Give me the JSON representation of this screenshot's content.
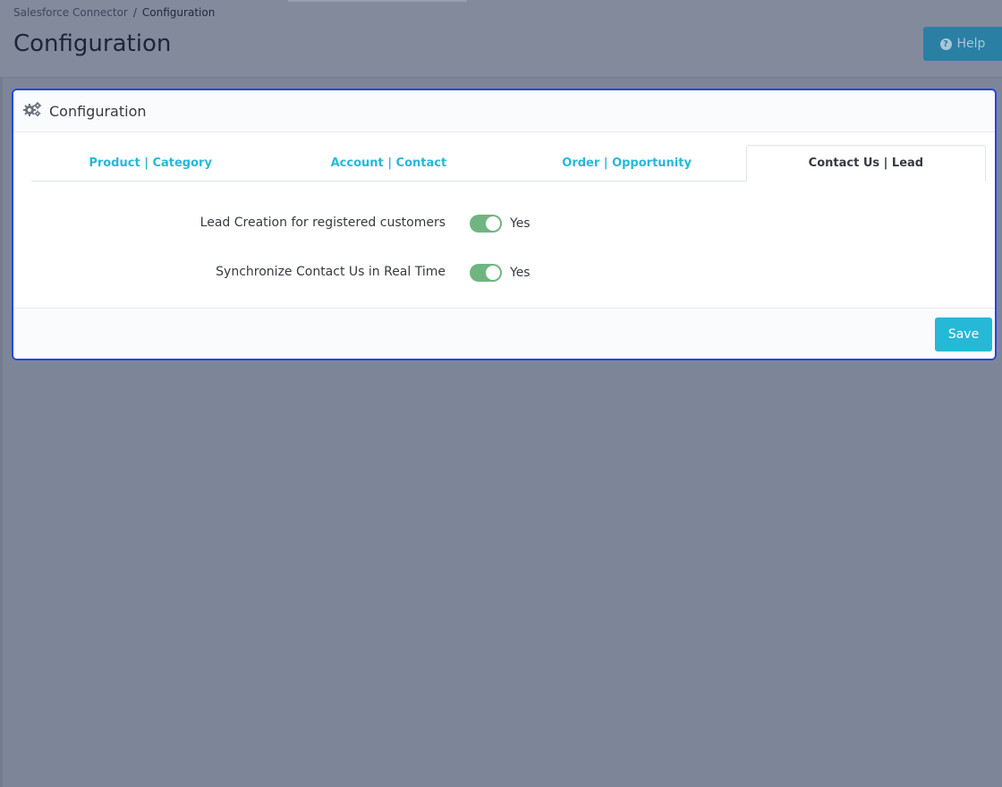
{
  "breadcrumb": {
    "parent": "Salesforce Connector",
    "separator": "/",
    "current": "Configuration"
  },
  "header": {
    "title": "Configuration",
    "help_label": "Help",
    "help_icon": "question-circle-icon"
  },
  "panel": {
    "title": "Configuration",
    "icon": "cogs-icon",
    "tabs": [
      {
        "label": "Product | Category",
        "active": false
      },
      {
        "label": "Account | Contact",
        "active": false
      },
      {
        "label": "Order | Opportunity",
        "active": false
      },
      {
        "label": "Contact Us | Lead",
        "active": true
      }
    ],
    "settings": [
      {
        "label": "Lead Creation for registered customers",
        "value": "Yes",
        "enabled": true
      },
      {
        "label": "Synchronize Contact Us in Real Time",
        "value": "Yes",
        "enabled": true
      }
    ],
    "save_label": "Save"
  },
  "colors": {
    "accent": "#25b9d7",
    "switch_on": "#70b580",
    "highlight_border": "#2445e6",
    "overlay": "#7d8699"
  }
}
